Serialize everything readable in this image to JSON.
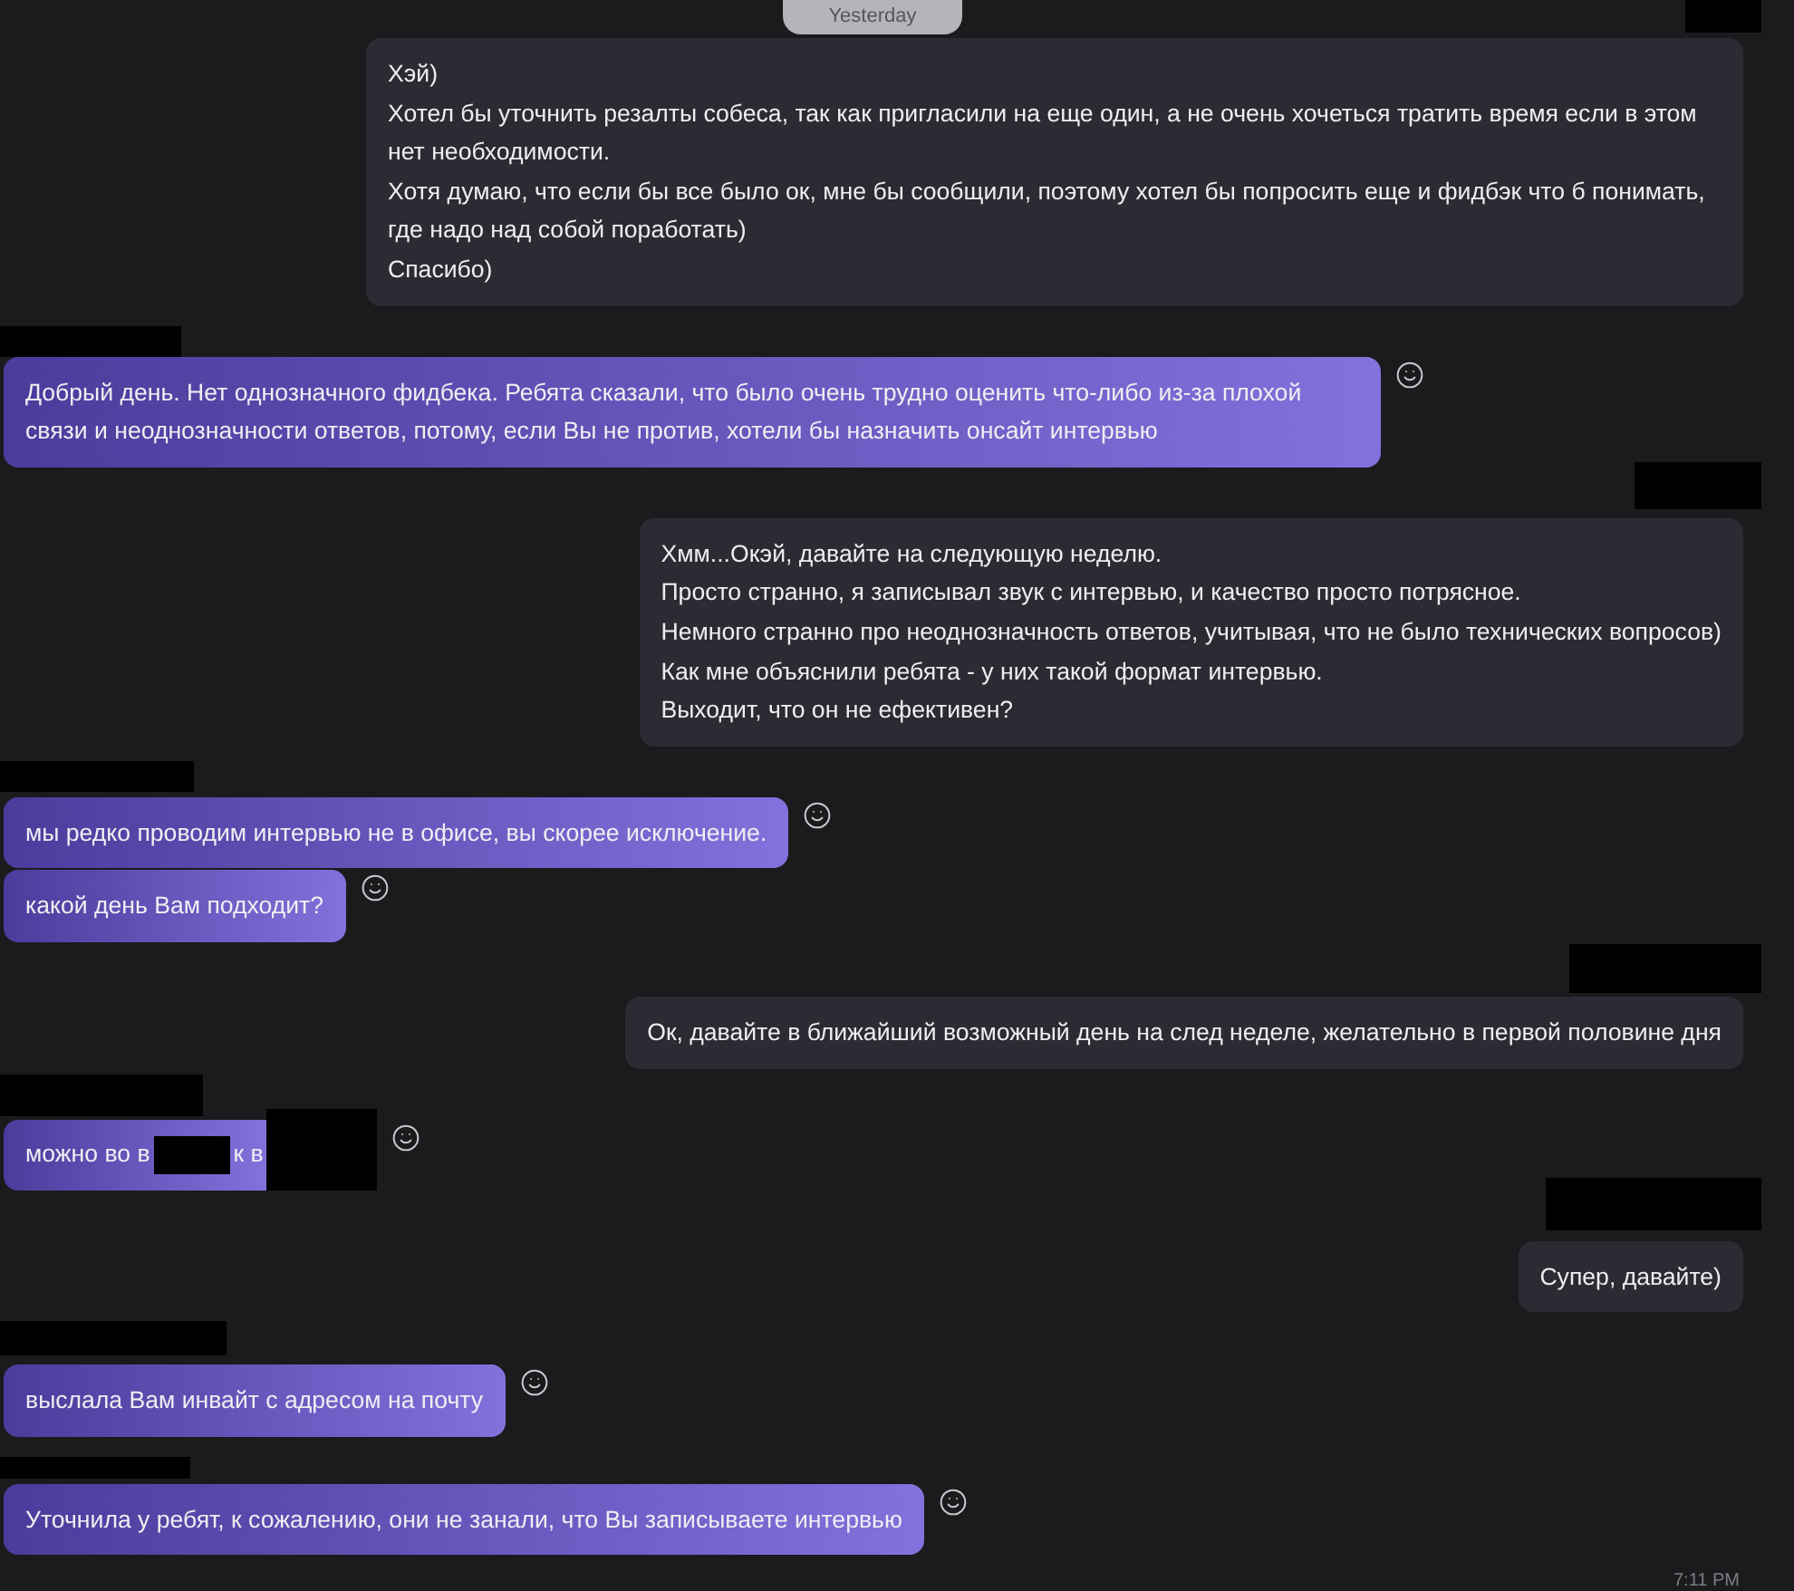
{
  "date_divider": "Yesterday",
  "messages": [
    {
      "kind": "outgoing",
      "sender_redacted": true,
      "text": "Хэй)\nХотел бы уточнить резалты собеса, так как пригласили на еще один, а не очень хочеться тратить время если в этом нет необходимости.\nХотя думаю, что если бы все было ок, мне бы сообщили, поэтому хотел бы попросить еще и фидбэк что б понимать, где надо над собой поработать)\nСпасибо)",
      "reaction_button": false
    },
    {
      "kind": "incoming",
      "sender_redacted": true,
      "text": "Добрый день. Нет однозначного фидбека. Ребята сказали, что было очень трудно оценить что-либо из-за плохой связи и неоднозначности ответов, потому, если Вы не против, хотели бы назначить онсайт интервью",
      "reaction_button": true
    },
    {
      "kind": "outgoing",
      "sender_redacted": true,
      "text": "Хмм...Окэй, давайте на следующую неделю.\nПросто странно, я записывал звук с интервью, и качество просто потрясное.\nНемного странно про неоднозначность ответов, учитывая, что не было технических вопросов)\nКак мне объяснили ребята - у них такой формат интервью.\nВыходит, что он не ефективен?",
      "reaction_button": false
    },
    {
      "kind": "incoming",
      "sender_redacted": true,
      "text": "мы редко проводим интервью не в офисе, вы скорее исключение.",
      "reaction_button": true
    },
    {
      "kind": "incoming",
      "sender_redacted": false,
      "text": "какой день Вам подходит?",
      "reaction_button": true
    },
    {
      "kind": "outgoing",
      "sender_redacted": true,
      "text": "Ок, давайте в ближайший возможный день на след неделе, желательно в первой половине дня",
      "reaction_button": false
    },
    {
      "kind": "incoming",
      "sender_redacted": true,
      "segments": [
        {
          "kind": "text",
          "text": "можно во в"
        },
        {
          "kind": "redaction"
        },
        {
          "kind": "text",
          "text": "к в"
        },
        {
          "kind": "redaction"
        }
      ],
      "reaction_button": true
    },
    {
      "kind": "outgoing",
      "sender_redacted": true,
      "text": "Супер, давайте)",
      "reaction_button": false
    },
    {
      "kind": "incoming",
      "sender_redacted": true,
      "text": "выслала Вам инвайт с адресом на почту",
      "reaction_button": true
    },
    {
      "kind": "incoming",
      "sender_redacted": true,
      "text": "Уточнила у ребят, к сожалению, они не занали, что Вы записываете интервью",
      "reaction_button": true
    }
  ],
  "timestamp": "7:11 PM"
}
